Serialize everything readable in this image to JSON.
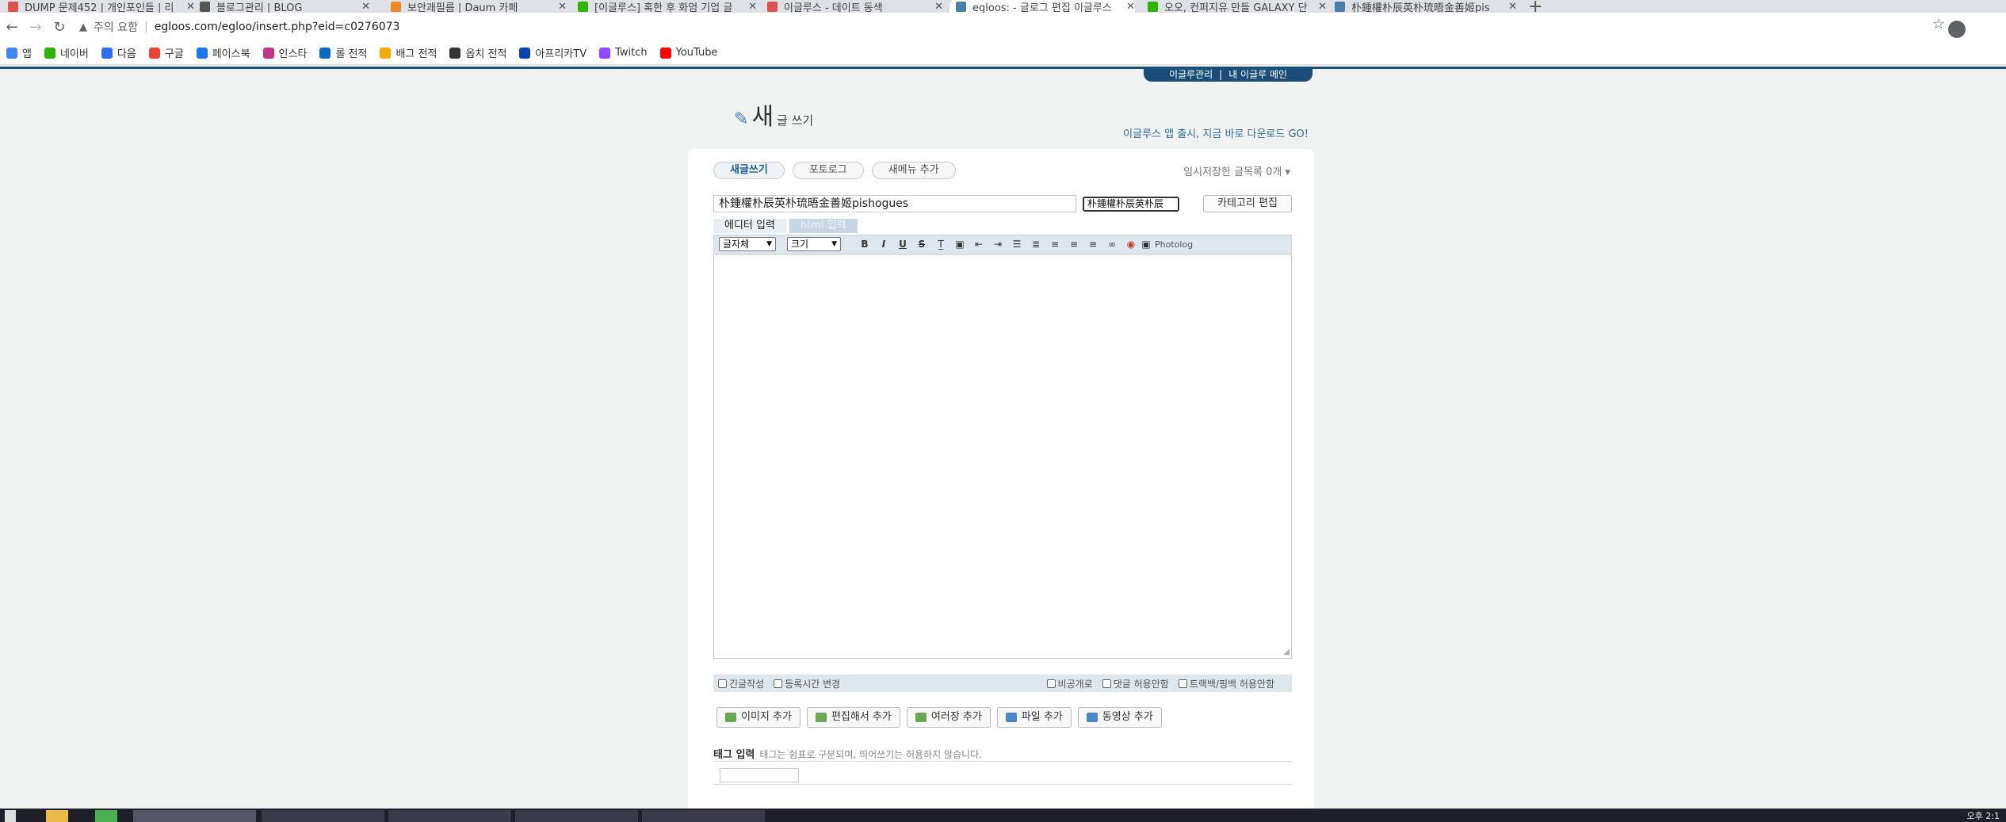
{
  "browser": {
    "tabs": [
      {
        "title": "DUMP 문제452 | 개인포인들 | 리",
        "favicon_color": "#d9534f"
      },
      {
        "title": "블로그관리 | BLOG",
        "favicon_color": "#555555"
      },
      {
        "title": "보안괘필름 | Daum 카페",
        "favicon_color": "#f08a24"
      },
      {
        "title": "[이글루스] 혹한 후 화엄 기업 글",
        "favicon_color": "#2db400"
      },
      {
        "title": "이글루스 - 데이트 동색",
        "favicon_color": "#d9534f"
      },
      {
        "title": "egloos: - 글로그 편집 이글루스",
        "favicon_color": "#4a7fa8"
      },
      {
        "title": "오오, 컨퍼지유 만들 GALAXY 단",
        "favicon_color": "#2db400"
      },
      {
        "title": "朴鍾權朴辰英朴琉晤金善姬pis",
        "favicon_color": "#4a7fa8"
      }
    ],
    "address": {
      "warning": "주의 요함",
      "url": "egloos.com/egloo/insert.php?eid=c0276073"
    },
    "bookmarks": [
      {
        "label": "앱",
        "color": "#4285f4"
      },
      {
        "label": "네이버",
        "color": "#2db400"
      },
      {
        "label": "다음",
        "color": "#2f6ff2"
      },
      {
        "label": "구글",
        "color": "#ea4335"
      },
      {
        "label": "페이스북",
        "color": "#1877f2"
      },
      {
        "label": "인스타",
        "color": "#c13584"
      },
      {
        "label": "롤 전적",
        "color": "#0a6abf"
      },
      {
        "label": "배그 전적",
        "color": "#f2a900"
      },
      {
        "label": "옵치 전적",
        "color": "#333333"
      },
      {
        "label": "아프리카TV",
        "color": "#0545b1"
      },
      {
        "label": "Twitch",
        "color": "#9146ff"
      },
      {
        "label": "YouTube",
        "color": "#ff0000"
      }
    ]
  },
  "admin_bar": {
    "manage": "이글루관리",
    "sep": "|",
    "main": "내 이글루 메인"
  },
  "header": {
    "logo_big": "새",
    "logo_small": "글 쓰기",
    "promo": "이글루스 앱 출시, 지금 바로 다운로드 GO!"
  },
  "write_tabs": [
    "새글쓰기",
    "포토로그",
    "새메뉴 추가"
  ],
  "temp_saved": "임시저장한 글목록 0개 ▾",
  "post": {
    "title_value": "朴鍾權朴辰英朴琉晤金善姬pishogues",
    "category_value": "朴鍾權朴辰英朴辰",
    "category_edit": "카테고리 편집"
  },
  "editor_modes": {
    "editor": "에디터 입력",
    "html": "html 입력"
  },
  "toolbar": {
    "font_family": "글자체",
    "font_size": "크기",
    "photolog": "Photolog"
  },
  "options": {
    "urgent": "긴글작성",
    "change_time": "등록시간 변경",
    "private": "비공개로",
    "no_comment": "댓글 허용안함",
    "no_trackback": "트랙백/핑백 허용안함"
  },
  "attach_buttons": [
    {
      "label": "이미지 추가",
      "color": "#6aa84f"
    },
    {
      "label": "편집해서 추가",
      "color": "#6aa84f"
    },
    {
      "label": "여러장 추가",
      "color": "#6aa84f"
    },
    {
      "label": "파일 추가",
      "color": "#4a86c8"
    },
    {
      "label": "동영상 추가",
      "color": "#4a86c8"
    }
  ],
  "tags": {
    "label": "태그 입력",
    "hint": "태그는 쉼표로 구분되며, 띄어쓰기는 허용하지 않습니다."
  },
  "taskbar": {
    "clock": "오후 2:1"
  }
}
